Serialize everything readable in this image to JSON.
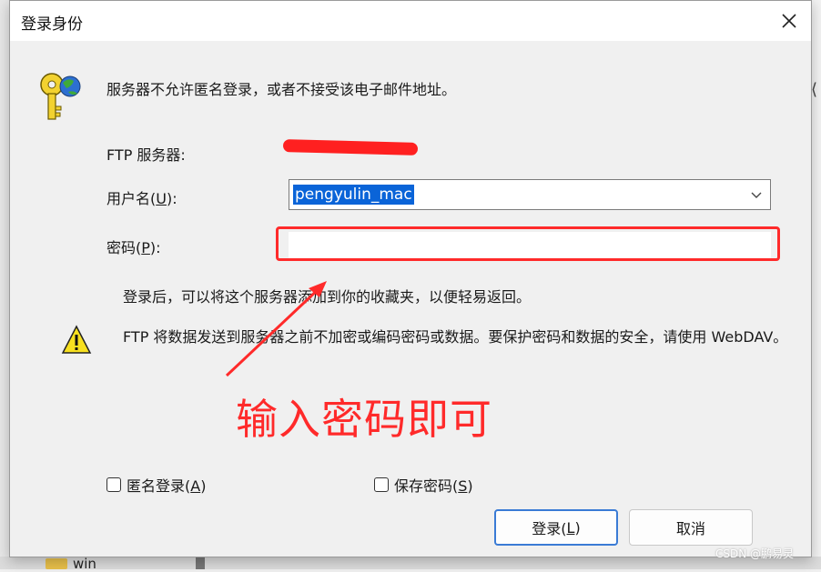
{
  "dialog": {
    "title": "登录身份",
    "message": "服务器不允许匿名登录，或者不接受该电子邮件地址。",
    "server_label": "FTP 服务器:",
    "username_label_prefix": "用户名(",
    "username_label_key": "U",
    "username_label_suffix": "):",
    "username_value": "pengyulin_mac",
    "password_label_prefix": "密码(",
    "password_label_key": "P",
    "password_label_suffix": "):",
    "password_value": "",
    "info_text": "登录后，可以将这个服务器添加到你的收藏夹，以便轻易返回。",
    "warning_text": "FTP 将数据发送到服务器之前不加密或编码密码或数据。要保护密码和数据的安全，请使用 WebDAV。",
    "anonymous_label_prefix": "匿名登录(",
    "anonymous_label_key": "A",
    "anonymous_label_suffix": ")",
    "save_password_label_prefix": "保存密码(",
    "save_password_label_key": "S",
    "save_password_label_suffix": ")",
    "login_button_prefix": "登录(",
    "login_button_key": "L",
    "login_button_suffix": ")",
    "cancel_button": "取消"
  },
  "annotation": {
    "text": "输入密码即可",
    "color": "#ff2a2a"
  },
  "background": {
    "folder_label": "win"
  },
  "watermark": "CSDN @鹏易灵",
  "icons": [
    "key-globe-icon",
    "warning-icon",
    "close-icon",
    "chevron-down-icon"
  ]
}
